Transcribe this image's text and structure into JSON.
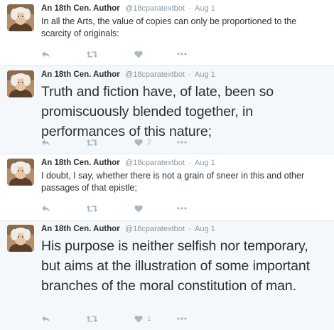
{
  "colors": {
    "text": "#292f33",
    "meta": "#8899a6",
    "action_icon": "#aab8c2",
    "highlight_bg": "#f5f8fa",
    "divider": "#e1e8ed"
  },
  "tweets": [
    {
      "author_name": "An 18th Cen. Author",
      "handle": "@18cparatextbot",
      "separator": "·",
      "time": "Aug 1",
      "text": "In all the Arts, the value of copies can only be proportioned to the scarcity of originals:",
      "like_count": "",
      "icons": [
        "reply-icon",
        "retweet-icon",
        "heart-icon",
        "more-icon"
      ]
    },
    {
      "author_name": "An 18th Cen. Author",
      "handle": "@18cparatextbot",
      "separator": "·",
      "time": "Aug 1",
      "text": "Truth and fiction have, of late, been so promiscuously blended together, in performances of this nature;",
      "like_count": "2",
      "icons": [
        "reply-icon",
        "retweet-icon",
        "heart-icon",
        "more-icon"
      ]
    },
    {
      "author_name": "An 18th Cen. Author",
      "handle": "@18cparatextbot",
      "separator": "·",
      "time": "Aug 1",
      "text": "I doubt, I say, whether there is not a grain of sneer in this and other passages of that epistle;",
      "like_count": "",
      "icons": [
        "reply-icon",
        "retweet-icon",
        "heart-icon",
        "more-icon"
      ]
    },
    {
      "author_name": "An 18th Cen. Author",
      "handle": "@18cparatextbot",
      "separator": "·",
      "time": "Aug 1",
      "text": "His purpose is neither selfish nor temporary, but aims at the illustration of some important branches of the moral constitution of man.",
      "like_count": "1",
      "icons": [
        "reply-icon",
        "retweet-icon",
        "heart-icon",
        "more-icon"
      ]
    }
  ]
}
